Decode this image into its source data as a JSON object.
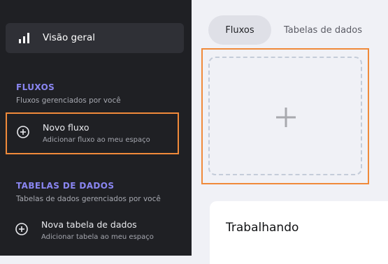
{
  "sidebar": {
    "overview_label": "Visão geral",
    "flows": {
      "title": "FLUXOS",
      "subtitle": "Fluxos gerenciados por você",
      "new_item": {
        "title": "Novo fluxo",
        "description": "Adicionar fluxo ao meu espaço"
      }
    },
    "tables": {
      "title": "TABELAS DE DADOS",
      "subtitle": "Tabelas de dados gerenciados por você",
      "new_item": {
        "title": "Nova tabela de dados",
        "description": "Adicionar tabela ao meu espaço"
      }
    }
  },
  "main": {
    "tabs": [
      {
        "label": "Fluxos",
        "active": true
      },
      {
        "label": "Tabelas de dados",
        "active": false
      }
    ],
    "add_area_icon": "plus-icon",
    "working_section_title": "Trabalhando"
  },
  "colors": {
    "sidebar_bg": "#1f2024",
    "accent_purple": "#8a86f2",
    "highlight_orange": "#f08a3a",
    "main_bg": "#f0f1f6"
  }
}
